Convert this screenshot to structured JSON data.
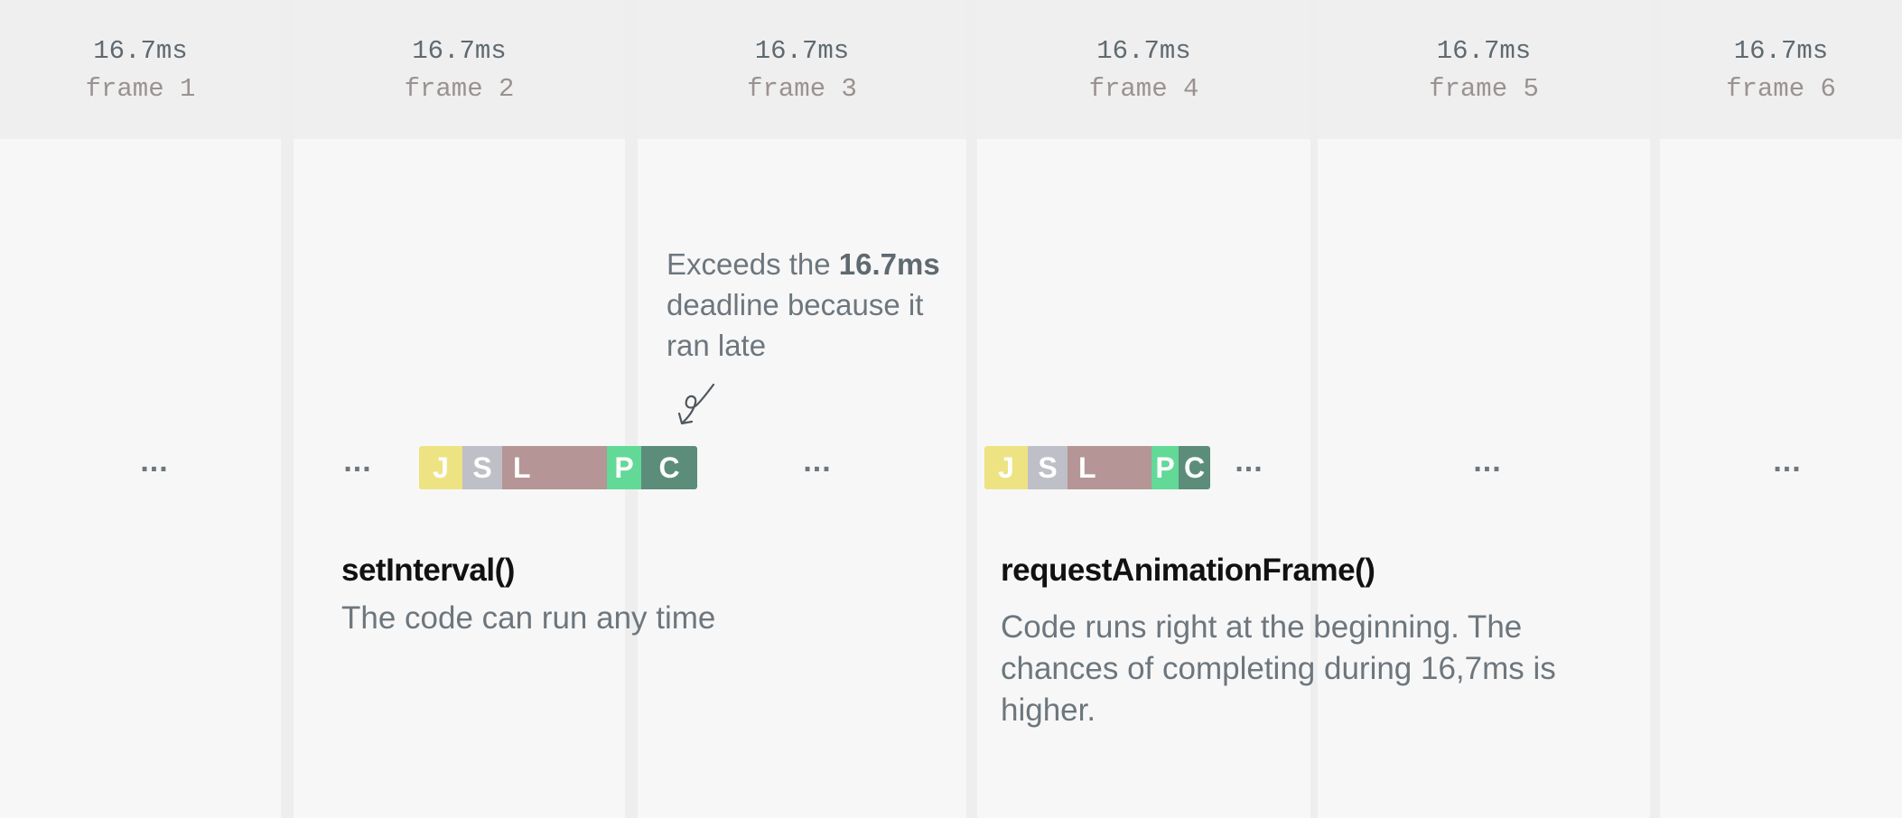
{
  "frames": [
    {
      "duration": "16.7ms",
      "label": "frame 1"
    },
    {
      "duration": "16.7ms",
      "label": "frame 2"
    },
    {
      "duration": "16.7ms",
      "label": "frame 3"
    },
    {
      "duration": "16.7ms",
      "label": "frame 4"
    },
    {
      "duration": "16.7ms",
      "label": "frame 5"
    },
    {
      "duration": "16.7ms",
      "label": "frame 6"
    }
  ],
  "ellipsis": "...",
  "task_segments": {
    "js": "J",
    "style": "S",
    "layout": "L",
    "paint": "P",
    "composite": "C"
  },
  "annotation": {
    "prefix": "Exceeds the ",
    "emphasis": "16.7ms",
    "suffix": " deadline because it ran late"
  },
  "set_interval": {
    "title": "setInterval()",
    "description": "The code can run any time"
  },
  "request_animation_frame": {
    "title": "requestAnimationFrame()",
    "description": "Code runs right at the beginning. The chances of completing during 16,7ms is higher."
  },
  "colors": {
    "js": "#ede383",
    "style": "#bfbfc8",
    "layout": "#b59595",
    "paint": "#62d997",
    "composite": "#5c8d7a"
  }
}
